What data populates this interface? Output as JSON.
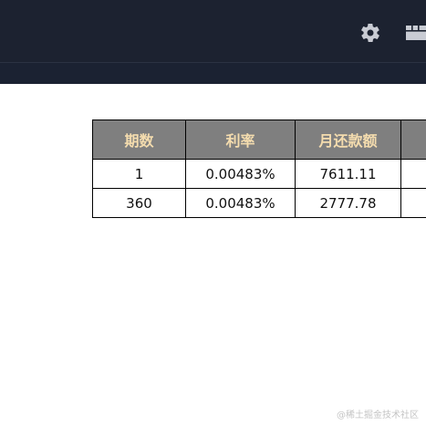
{
  "header": {
    "icons": [
      "gear-icon",
      "board-icon"
    ],
    "background": "#1c2230"
  },
  "table": {
    "headers": [
      "期数",
      "利率",
      "月还款额",
      ""
    ],
    "rows": [
      [
        "1",
        "0.00483%",
        "7611.11",
        ""
      ],
      [
        "360",
        "0.00483%",
        "2777.78",
        ""
      ]
    ],
    "header_bg": "#7f7f7f",
    "header_text_color": "#f4dcae"
  },
  "watermark": "@稀土掘金技术社区"
}
